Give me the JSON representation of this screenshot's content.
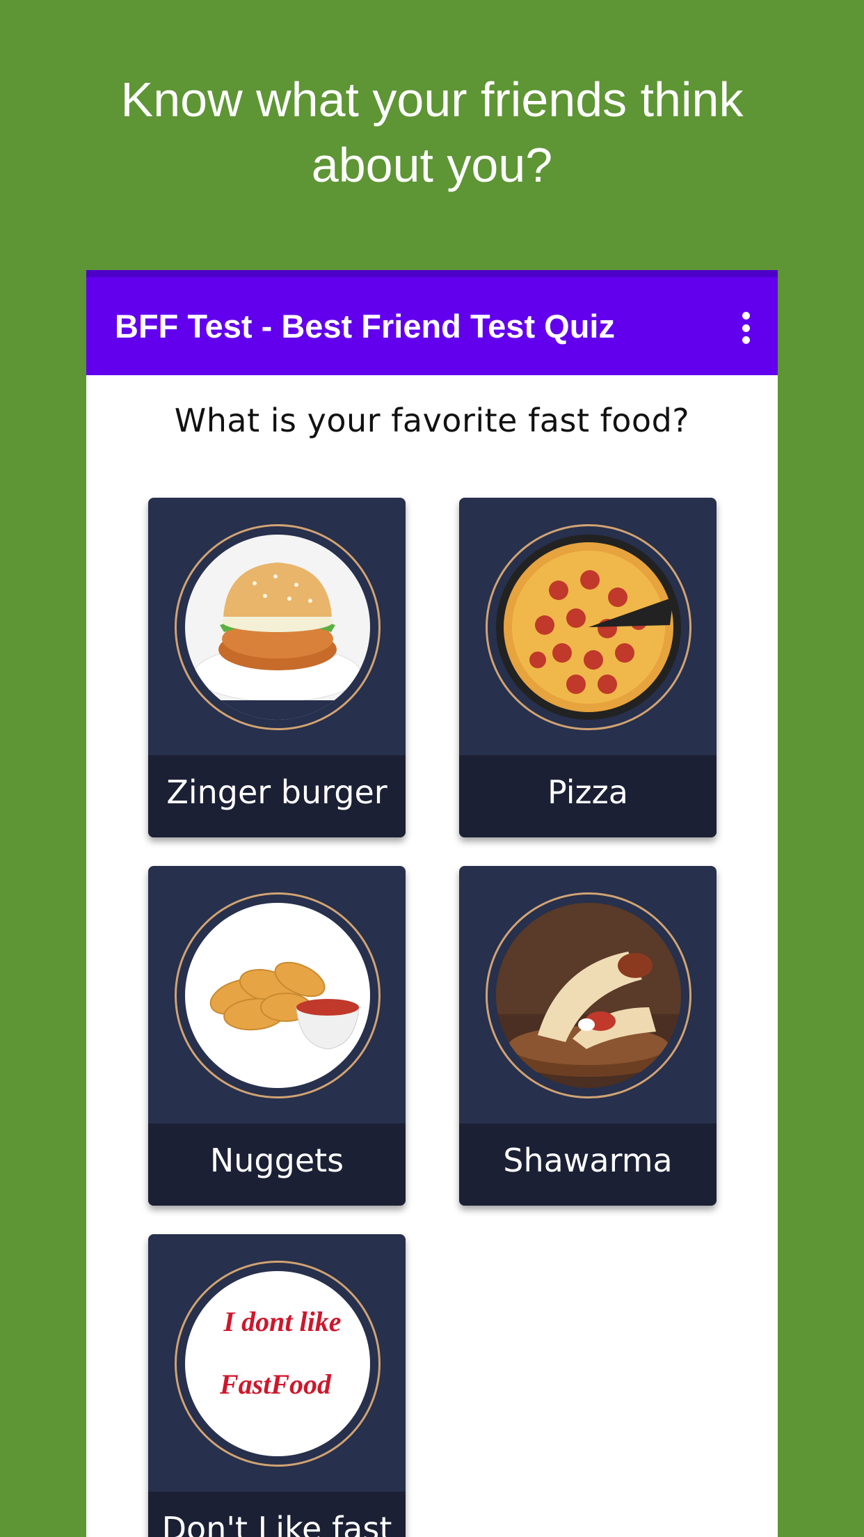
{
  "headline": {
    "line1": "Know what your friends think",
    "line2": "about you?"
  },
  "app": {
    "title": "BFF Test - Best Friend Test Quiz",
    "menu_icon": "more-vert-icon"
  },
  "quiz": {
    "question": "What is your favorite fast food?",
    "options": [
      {
        "label": "Zinger burger",
        "image": "zinger-burger-image"
      },
      {
        "label": "Pizza",
        "image": "pizza-image"
      },
      {
        "label": "Nuggets",
        "image": "nuggets-image"
      },
      {
        "label": "Shawarma",
        "image": "shawarma-image"
      },
      {
        "label": "Don't Like fast",
        "image": "dont-like-fastfood-image",
        "image_text_line1": "I dont like",
        "image_text_line2": "FastFood"
      }
    ]
  },
  "colors": {
    "background": "#5e9535",
    "app_bar": "#6200ee",
    "card": "#27304c",
    "card_label": "#1c2035",
    "ring": "#d1a373"
  }
}
